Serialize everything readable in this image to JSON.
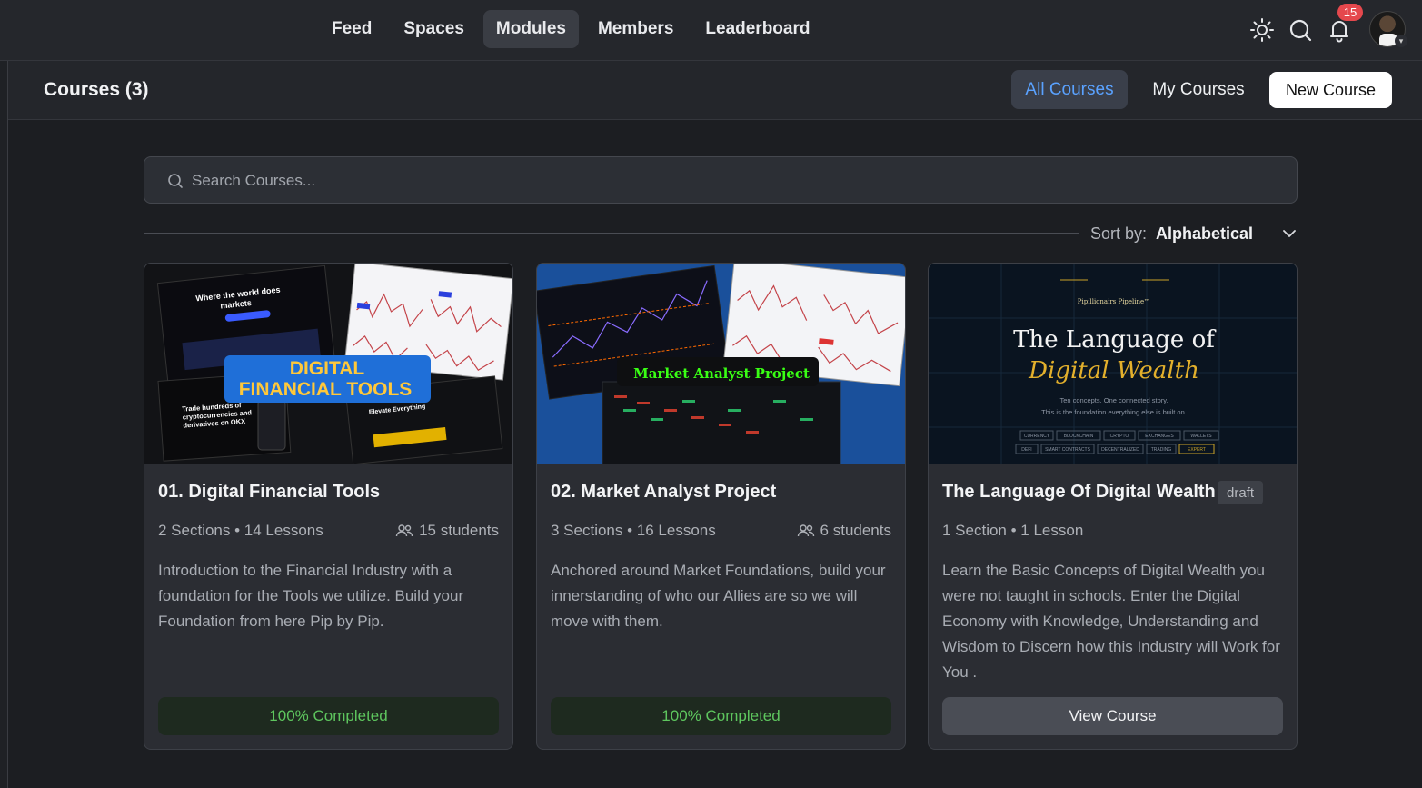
{
  "nav": {
    "tabs": [
      {
        "label": "Feed"
      },
      {
        "label": "Spaces"
      },
      {
        "label": "Modules"
      },
      {
        "label": "Members"
      },
      {
        "label": "Leaderboard"
      }
    ],
    "active_tab": "Modules",
    "notifications_count": "15"
  },
  "header": {
    "title": "Courses (3)",
    "all_courses_label": "All Courses",
    "my_courses_label": "My Courses",
    "new_course_label": "New Course"
  },
  "search": {
    "placeholder": "Search Courses..."
  },
  "sort": {
    "label": "Sort by:",
    "value": "Alphabetical"
  },
  "thumbs": {
    "t1_line1": "Where the world does",
    "t1_line2": "markets",
    "t1_banner1": "DIGITAL",
    "t1_banner2": "FINANCIAL TOOLS",
    "t1_side1": "Trade hundreds of",
    "t1_side2": "cryptocurrencies and",
    "t1_side3": "derivatives on OKX",
    "t1_promo": "Elevate Everything",
    "t2_banner": "Market Analyst Project",
    "t3_brand": "Pipillionairs Pipeline™",
    "t3_title1": "The Language of",
    "t3_title2": "Digital Wealth",
    "t3_sub1": "Ten concepts. One connected story.",
    "t3_sub2": "This is the foundation everything else is built on.",
    "t3_tags_row1": [
      "CURRENCY",
      "BLOCKCHAIN",
      "CRYPTO",
      "EXCHANGES",
      "WALLETS"
    ],
    "t3_tags_row2": [
      "DEFI",
      "SMART CONTRACTS",
      "DECENTRALIZED",
      "TRADING",
      "EXPERT"
    ]
  },
  "courses": [
    {
      "title": "01. Digital Financial Tools",
      "meta": "2 Sections • 14 Lessons",
      "students": "15 students",
      "description": "Introduction to the Financial Industry with a foundation for the Tools we utilize. Build your Foundation from here Pip by Pip.",
      "progress": "100% Completed"
    },
    {
      "title": "02. Market Analyst Project",
      "meta": "3 Sections • 16 Lessons",
      "students": "6 students",
      "description": "Anchored around Market Foundations, build your innerstanding of who our Allies are so we will move with them.",
      "progress": "100% Completed"
    },
    {
      "title": "The Language Of Digital Wealth",
      "badge": "draft",
      "meta": "1 Section • 1 Lesson",
      "description": "Learn the Basic Concepts of Digital Wealth you were not taught in schools. Enter the Digital Economy with Knowledge, Understanding and Wisdom to Discern how this Industry will Work for You .",
      "action": "View Course"
    }
  ]
}
